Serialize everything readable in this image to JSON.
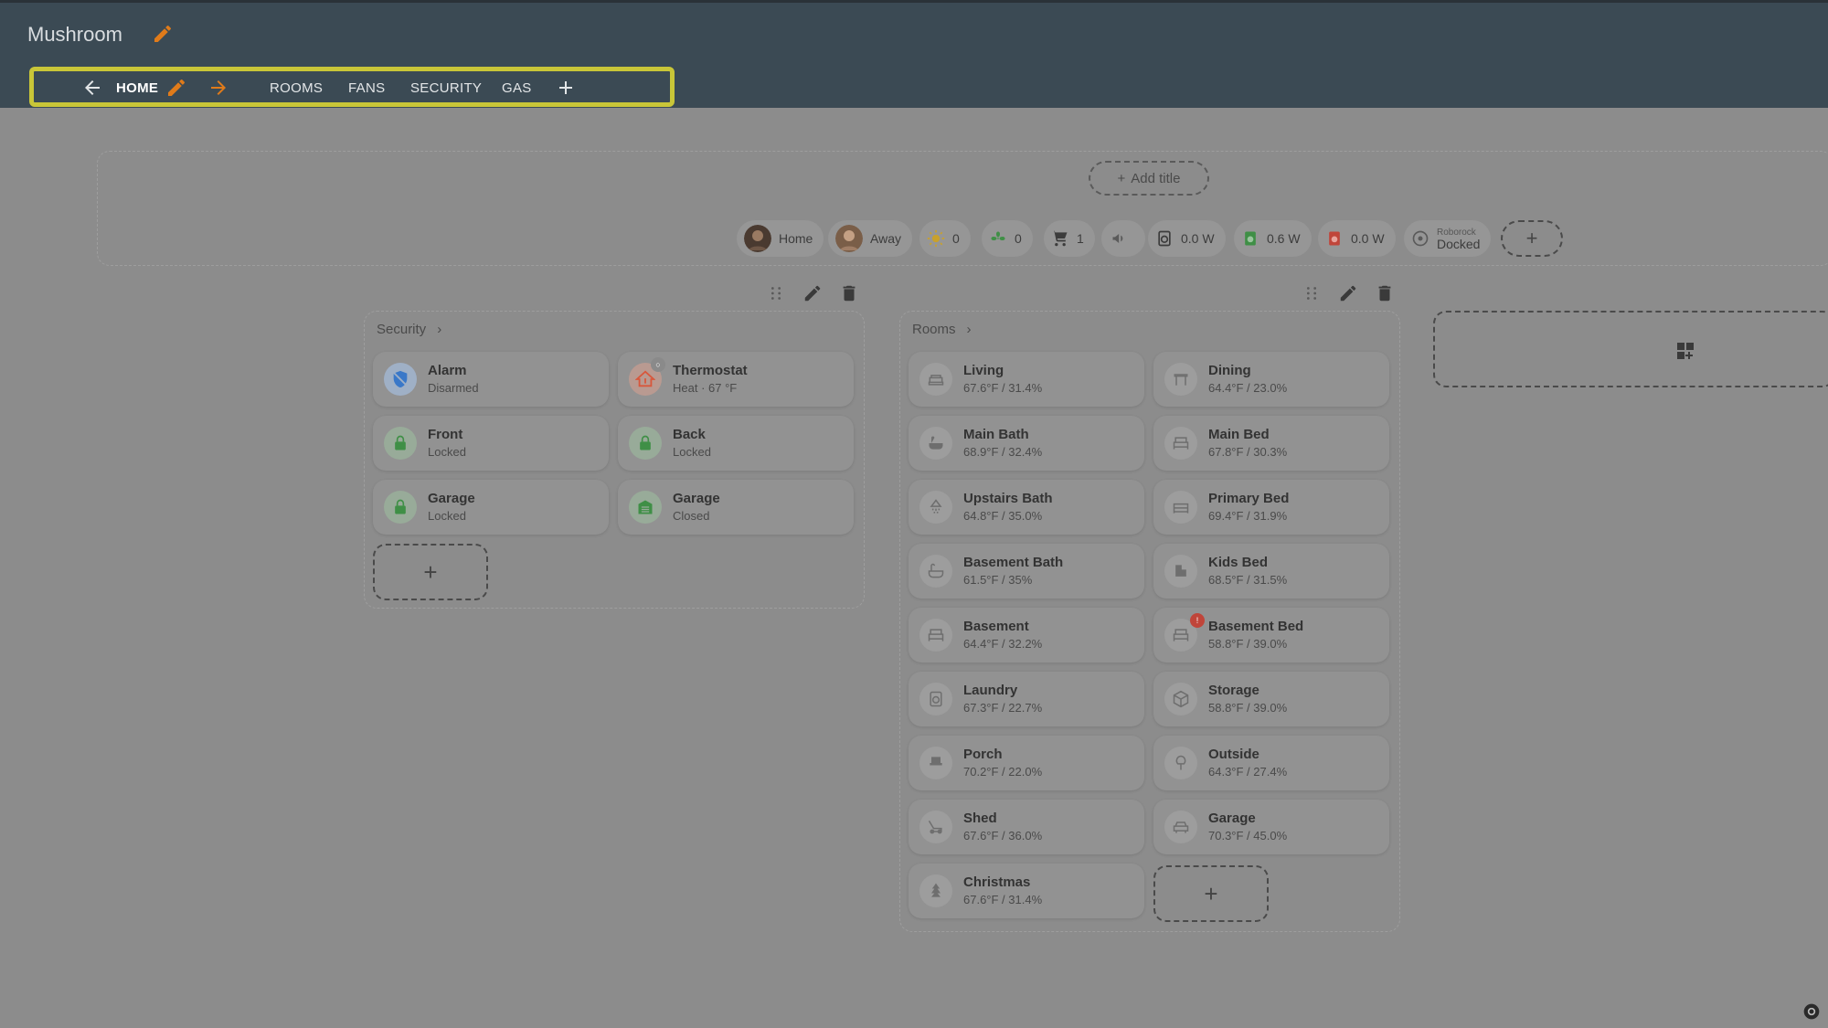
{
  "app": {
    "title": "Mushroom"
  },
  "tabs": [
    {
      "label": "HOME"
    },
    {
      "label": "ROOMS"
    },
    {
      "label": "FANS"
    },
    {
      "label": "SECURITY"
    },
    {
      "label": "GAS"
    }
  ],
  "header_section": {
    "add_title_label": "Add title",
    "chips": [
      {
        "label": "Home"
      },
      {
        "label": "Away"
      },
      {
        "label": "0"
      },
      {
        "label": "0"
      },
      {
        "label": "1"
      },
      {
        "label": ""
      },
      {
        "label": "0.0 W"
      },
      {
        "label": "0.6 W"
      },
      {
        "label": "0.0 W"
      },
      {
        "top": "Roborock",
        "label": "Docked"
      }
    ]
  },
  "security": {
    "title": "Security",
    "tiles": [
      {
        "name": "Alarm",
        "state": "Disarmed"
      },
      {
        "name": "Thermostat",
        "state": "Heat · 67 °F"
      },
      {
        "name": "Front",
        "state": "Locked"
      },
      {
        "name": "Back",
        "state": "Locked"
      },
      {
        "name": "Garage",
        "state": "Locked"
      },
      {
        "name": "Garage",
        "state": "Closed"
      }
    ]
  },
  "rooms": {
    "title": "Rooms",
    "tiles": [
      {
        "name": "Living",
        "state": "67.6°F / 31.4%"
      },
      {
        "name": "Dining",
        "state": "64.4°F / 23.0%"
      },
      {
        "name": "Main Bath",
        "state": "68.9°F / 32.4%"
      },
      {
        "name": "Main Bed",
        "state": "67.8°F / 30.3%"
      },
      {
        "name": "Upstairs Bath",
        "state": "64.8°F / 35.0%"
      },
      {
        "name": "Primary Bed",
        "state": "69.4°F / 31.9%"
      },
      {
        "name": "Basement Bath",
        "state": "61.5°F / 35%"
      },
      {
        "name": "Kids Bed",
        "state": "68.5°F / 31.5%"
      },
      {
        "name": "Basement",
        "state": "64.4°F / 32.2%"
      },
      {
        "name": "Basement Bed",
        "state": "58.8°F / 39.0%"
      },
      {
        "name": "Laundry",
        "state": "67.3°F / 22.7%"
      },
      {
        "name": "Storage",
        "state": "58.8°F / 39.0%"
      },
      {
        "name": "Porch",
        "state": "70.2°F / 22.0%"
      },
      {
        "name": "Outside",
        "state": "64.3°F / 27.4%"
      },
      {
        "name": "Shed",
        "state": "67.6°F / 36.0%"
      },
      {
        "name": "Garage",
        "state": "70.3°F / 45.0%"
      },
      {
        "name": "Christmas",
        "state": "67.6°F / 31.4%"
      }
    ]
  },
  "colors": {
    "accent_pencil": "#e07b1a",
    "tab_highlight": "#c9c638",
    "lock_green": "#3f8f46",
    "alarm_blue": "#3a78c8",
    "thermostat_red": "#d8573c"
  }
}
